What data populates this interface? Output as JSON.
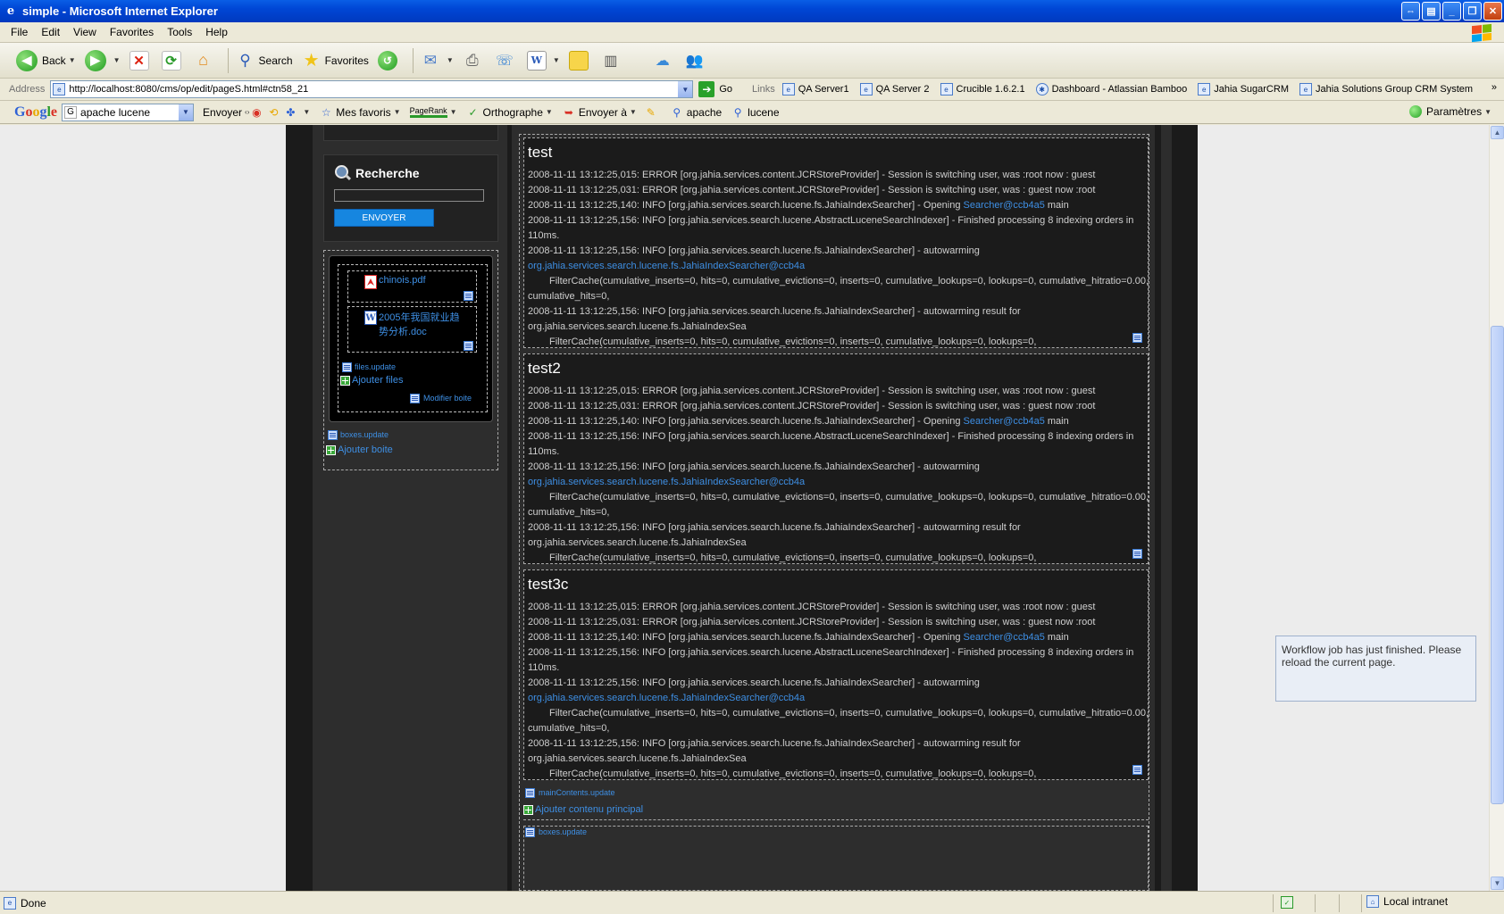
{
  "window": {
    "title": "simple - Microsoft Internet Explorer"
  },
  "menu": [
    "File",
    "Edit",
    "View",
    "Favorites",
    "Tools",
    "Help"
  ],
  "toolbar": {
    "back": "Back",
    "search": "Search",
    "favorites": "Favorites"
  },
  "address": {
    "label": "Address",
    "url": "http://localhost:8080/cms/op/edit/pageS.html#ctn58_21",
    "go": "Go"
  },
  "links": {
    "label": "Links",
    "items": [
      "QA Server1",
      "QA Server 2",
      "Crucible 1.6.2.1",
      "Dashboard - Atlassian Bamboo",
      "Jahia SugarCRM",
      "Jahia Solutions Group CRM System"
    ]
  },
  "google": {
    "logo": "Google",
    "query": "apache lucene",
    "envoyer": "Envoyer",
    "mes_favoris": "Mes favoris",
    "pagerank": "PageRank",
    "orthographe": "Orthographe",
    "envoyer_a": "Envoyer à",
    "apache": "apache",
    "lucene": "lucene",
    "parametres": "Paramètres"
  },
  "sidebar": {
    "search_title": "Recherche",
    "send_button": "ENVOYER",
    "files": [
      {
        "name": "chinois.pdf"
      },
      {
        "name_line1": "2005年我国就业趋",
        "name_line2": "势分析.doc"
      }
    ],
    "files_update": "files.update",
    "add_files": "Ajouter files",
    "modify_box": "Modifier boite",
    "boxes_update": "boxes.update",
    "add_box": "Ajouter boite"
  },
  "main": {
    "blocks": [
      {
        "title": "test",
        "lines": [
          "2008-11-11 13:12:25,015: ERROR [org.jahia.services.content.JCRStoreProvider] - Session is switching user, was :root now : guest",
          "2008-11-11 13:12:25,031: ERROR [org.jahia.services.content.JCRStoreProvider] - Session is switching user, was : guest  now :root",
          "2008-11-11 13:12:25,140: INFO  [org.jahia.services.search.lucene.fs.JahiaIndexSearcher] - Opening ",
          "Searcher@ccb4a5",
          " main",
          "2008-11-11 13:12:25,156: INFO  [org.jahia.services.search.lucene.AbstractLuceneSearchIndexer] - Finished processing 8 indexing orders in",
          "110ms.",
          "2008-11-11 13:12:25,156: INFO  [org.jahia.services.search.lucene.fs.JahiaIndexSearcher] - autowarming",
          "org.jahia.services.search.lucene.fs.JahiaIndexSearcher@ccb4a",
          "FilterCache(cumulative_inserts=0, hits=0, cumulative_evictions=0, inserts=0, cumulative_lookups=0, lookups=0, cumulative_hitratio=0.00,",
          "cumulative_hits=0,",
          "2008-11-11 13:12:25,156: INFO  [org.jahia.services.search.lucene.fs.JahiaIndexSearcher] - autowarming result for",
          "org.jahia.services.search.lucene.fs.JahiaIndexSea",
          "FilterCache(cumulative_inserts=0, hits=0, cumulative_evictions=0, inserts=0, cumulative_lookups=0, lookups=0,"
        ]
      },
      {
        "title": "test2",
        "lines": [
          "2008-11-11 13:12:25,015: ERROR [org.jahia.services.content.JCRStoreProvider] - Session is switching user, was :root now : guest",
          "2008-11-11 13:12:25,031: ERROR [org.jahia.services.content.JCRStoreProvider] - Session is switching user, was : guest  now :root",
          "2008-11-11 13:12:25,140: INFO  [org.jahia.services.search.lucene.fs.JahiaIndexSearcher] - Opening ",
          "Searcher@ccb4a5",
          " main",
          "2008-11-11 13:12:25,156: INFO  [org.jahia.services.search.lucene.AbstractLuceneSearchIndexer] - Finished processing 8 indexing orders in",
          "110ms.",
          "2008-11-11 13:12:25,156: INFO  [org.jahia.services.search.lucene.fs.JahiaIndexSearcher] - autowarming",
          "org.jahia.services.search.lucene.fs.JahiaIndexSearcher@ccb4a",
          "FilterCache(cumulative_inserts=0, hits=0, cumulative_evictions=0, inserts=0, cumulative_lookups=0, lookups=0, cumulative_hitratio=0.00,",
          "cumulative_hits=0,",
          "2008-11-11 13:12:25,156: INFO  [org.jahia.services.search.lucene.fs.JahiaIndexSearcher] - autowarming result for",
          "org.jahia.services.search.lucene.fs.JahiaIndexSea",
          "FilterCache(cumulative_inserts=0, hits=0, cumulative_evictions=0, inserts=0, cumulative_lookups=0, lookups=0,"
        ]
      },
      {
        "title": "test3c",
        "lines": [
          "2008-11-11 13:12:25,015: ERROR [org.jahia.services.content.JCRStoreProvider] - Session is switching user, was :root now : guest",
          "2008-11-11 13:12:25,031: ERROR [org.jahia.services.content.JCRStoreProvider] - Session is switching user, was : guest  now :root",
          "2008-11-11 13:12:25,140: INFO  [org.jahia.services.search.lucene.fs.JahiaIndexSearcher] - Opening ",
          "Searcher@ccb4a5",
          " main",
          "2008-11-11 13:12:25,156: INFO  [org.jahia.services.search.lucene.AbstractLuceneSearchIndexer] - Finished processing 8 indexing orders in",
          "110ms.",
          "2008-11-11 13:12:25,156: INFO  [org.jahia.services.search.lucene.fs.JahiaIndexSearcher] - autowarming",
          "org.jahia.services.search.lucene.fs.JahiaIndexSearcher@ccb4a",
          "FilterCache(cumulative_inserts=0, hits=0, cumulative_evictions=0, inserts=0, cumulative_lookups=0, lookups=0, cumulative_hitratio=0.00,",
          "cumulative_hits=0,",
          "2008-11-11 13:12:25,156: INFO  [org.jahia.services.search.lucene.fs.JahiaIndexSearcher] - autowarming result for",
          "org.jahia.services.search.lucene.fs.JahiaIndexSea",
          "FilterCache(cumulative_inserts=0, hits=0, cumulative_evictions=0, inserts=0, cumulative_lookups=0, lookups=0,"
        ]
      }
    ],
    "main_contents_update": "mainContents.update",
    "add_main_content": "Ajouter contenu principal",
    "boxes_update": "boxes.update"
  },
  "notification": "Workflow job has just finished. Please reload the current page.",
  "status": {
    "text": "Done",
    "zone": "Local intranet"
  },
  "colors": {
    "link": "#3e8fe4",
    "page_bg": "#1b1b1b",
    "column_bg": "#2d2d2d",
    "send_button": "#1686e0"
  }
}
